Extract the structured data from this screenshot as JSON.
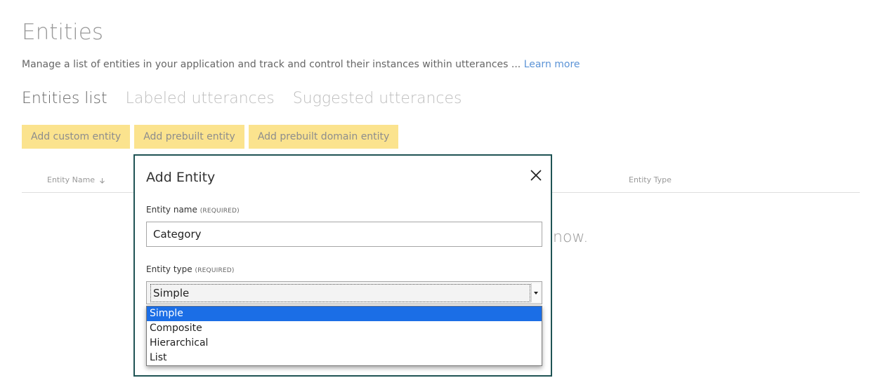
{
  "page": {
    "title": "Entities",
    "description": "Manage a list of entities in your application and track and control their instances within utterances ...",
    "learn_more": "Learn more"
  },
  "tabs": [
    {
      "label": "Entities list",
      "active": true
    },
    {
      "label": "Labeled utterances",
      "active": false
    },
    {
      "label": "Suggested utterances",
      "active": false
    }
  ],
  "actions": {
    "custom": "Add custom entity",
    "prebuilt": "Add prebuilt entity",
    "prebuilt_domain": "Add prebuilt domain entity"
  },
  "table": {
    "col_name": "Entity Name",
    "col_type": "Entity Type",
    "empty_fragment": "now."
  },
  "modal": {
    "title": "Add Entity",
    "name_label": "Entity name",
    "name_required": "(REQUIRED)",
    "name_value": "Category",
    "type_label": "Entity type",
    "type_required": "(REQUIRED)",
    "type_value": "Simple",
    "options": [
      "Simple",
      "Composite",
      "Hierarchical",
      "List"
    ],
    "selected_option": "Simple"
  },
  "colors": {
    "accent_button": "#fbe38e",
    "modal_border": "#1f5354",
    "link": "#5b93d6",
    "selection": "#1b6ee6"
  },
  "icons": {
    "close": "close-icon",
    "sort": "sort-arrow-icon",
    "dropdown": "dropdown-arrow-icon"
  }
}
